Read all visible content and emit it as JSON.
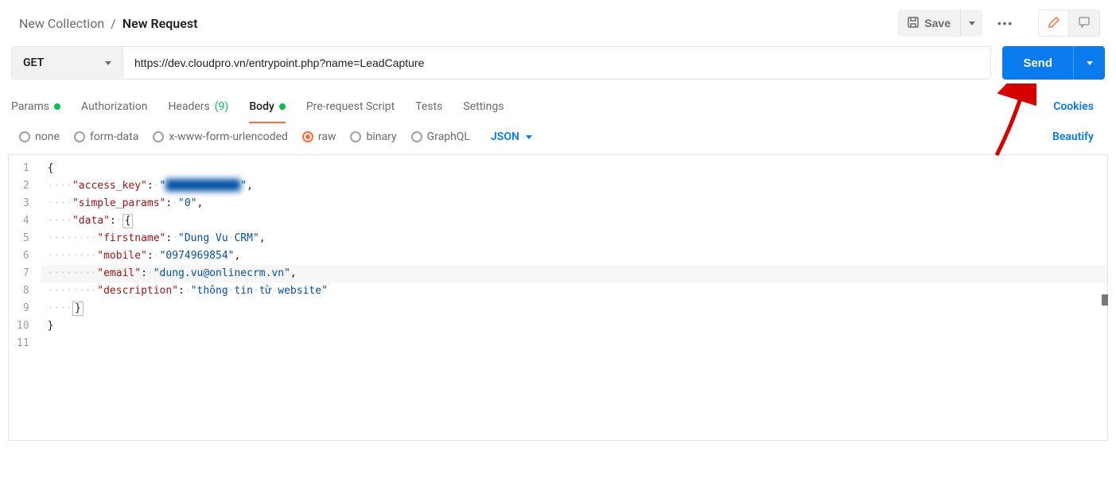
{
  "breadcrumb": {
    "collection": "New Collection",
    "separator": "/",
    "request": "New Request"
  },
  "header": {
    "save_label": "Save",
    "more_label": "•••"
  },
  "request": {
    "method": "GET",
    "url": "https://dev.cloudpro.vn/entrypoint.php?name=LeadCapture",
    "send_label": "Send"
  },
  "tabs": {
    "params": "Params",
    "authorization": "Authorization",
    "headers": "Headers",
    "headers_count": "(9)",
    "body": "Body",
    "prerequest": "Pre-request Script",
    "tests": "Tests",
    "settings": "Settings",
    "cookies": "Cookies"
  },
  "body_options": {
    "none": "none",
    "form_data": "form-data",
    "urlencoded": "x-www-form-urlencoded",
    "raw": "raw",
    "binary": "binary",
    "graphql": "GraphQL",
    "format": "JSON",
    "beautify": "Beautify"
  },
  "editor": {
    "line_numbers": [
      "1",
      "2",
      "3",
      "4",
      "5",
      "6",
      "7",
      "8",
      "9",
      "10",
      "11"
    ],
    "json": {
      "access_key_value": "████████████",
      "simple_params": "0",
      "data": {
        "firstname": "Dung Vu CRM",
        "mobile": "0974969854",
        "email": "dung.vu@onlinecrm.vn",
        "description": "thông tin từ website"
      }
    }
  }
}
